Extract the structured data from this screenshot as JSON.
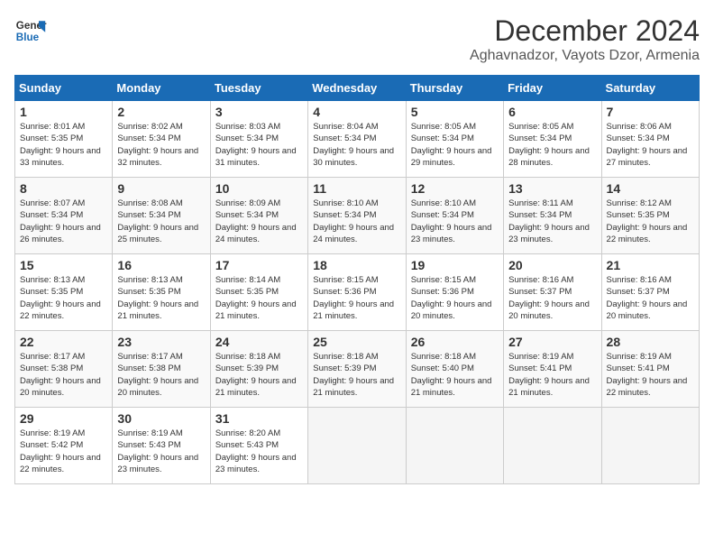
{
  "logo": {
    "line1": "General",
    "line2": "Blue"
  },
  "title": "December 2024",
  "subtitle": "Aghavnadzor, Vayots Dzor, Armenia",
  "days_of_week": [
    "Sunday",
    "Monday",
    "Tuesday",
    "Wednesday",
    "Thursday",
    "Friday",
    "Saturday"
  ],
  "weeks": [
    [
      {
        "day": "1",
        "sunrise": "8:01 AM",
        "sunset": "5:35 PM",
        "daylight": "9 hours and 33 minutes."
      },
      {
        "day": "2",
        "sunrise": "8:02 AM",
        "sunset": "5:34 PM",
        "daylight": "9 hours and 32 minutes."
      },
      {
        "day": "3",
        "sunrise": "8:03 AM",
        "sunset": "5:34 PM",
        "daylight": "9 hours and 31 minutes."
      },
      {
        "day": "4",
        "sunrise": "8:04 AM",
        "sunset": "5:34 PM",
        "daylight": "9 hours and 30 minutes."
      },
      {
        "day": "5",
        "sunrise": "8:05 AM",
        "sunset": "5:34 PM",
        "daylight": "9 hours and 29 minutes."
      },
      {
        "day": "6",
        "sunrise": "8:05 AM",
        "sunset": "5:34 PM",
        "daylight": "9 hours and 28 minutes."
      },
      {
        "day": "7",
        "sunrise": "8:06 AM",
        "sunset": "5:34 PM",
        "daylight": "9 hours and 27 minutes."
      }
    ],
    [
      {
        "day": "8",
        "sunrise": "8:07 AM",
        "sunset": "5:34 PM",
        "daylight": "9 hours and 26 minutes."
      },
      {
        "day": "9",
        "sunrise": "8:08 AM",
        "sunset": "5:34 PM",
        "daylight": "9 hours and 25 minutes."
      },
      {
        "day": "10",
        "sunrise": "8:09 AM",
        "sunset": "5:34 PM",
        "daylight": "9 hours and 24 minutes."
      },
      {
        "day": "11",
        "sunrise": "8:10 AM",
        "sunset": "5:34 PM",
        "daylight": "9 hours and 24 minutes."
      },
      {
        "day": "12",
        "sunrise": "8:10 AM",
        "sunset": "5:34 PM",
        "daylight": "9 hours and 23 minutes."
      },
      {
        "day": "13",
        "sunrise": "8:11 AM",
        "sunset": "5:34 PM",
        "daylight": "9 hours and 23 minutes."
      },
      {
        "day": "14",
        "sunrise": "8:12 AM",
        "sunset": "5:35 PM",
        "daylight": "9 hours and 22 minutes."
      }
    ],
    [
      {
        "day": "15",
        "sunrise": "8:13 AM",
        "sunset": "5:35 PM",
        "daylight": "9 hours and 22 minutes."
      },
      {
        "day": "16",
        "sunrise": "8:13 AM",
        "sunset": "5:35 PM",
        "daylight": "9 hours and 21 minutes."
      },
      {
        "day": "17",
        "sunrise": "8:14 AM",
        "sunset": "5:35 PM",
        "daylight": "9 hours and 21 minutes."
      },
      {
        "day": "18",
        "sunrise": "8:15 AM",
        "sunset": "5:36 PM",
        "daylight": "9 hours and 21 minutes."
      },
      {
        "day": "19",
        "sunrise": "8:15 AM",
        "sunset": "5:36 PM",
        "daylight": "9 hours and 20 minutes."
      },
      {
        "day": "20",
        "sunrise": "8:16 AM",
        "sunset": "5:37 PM",
        "daylight": "9 hours and 20 minutes."
      },
      {
        "day": "21",
        "sunrise": "8:16 AM",
        "sunset": "5:37 PM",
        "daylight": "9 hours and 20 minutes."
      }
    ],
    [
      {
        "day": "22",
        "sunrise": "8:17 AM",
        "sunset": "5:38 PM",
        "daylight": "9 hours and 20 minutes."
      },
      {
        "day": "23",
        "sunrise": "8:17 AM",
        "sunset": "5:38 PM",
        "daylight": "9 hours and 20 minutes."
      },
      {
        "day": "24",
        "sunrise": "8:18 AM",
        "sunset": "5:39 PM",
        "daylight": "9 hours and 21 minutes."
      },
      {
        "day": "25",
        "sunrise": "8:18 AM",
        "sunset": "5:39 PM",
        "daylight": "9 hours and 21 minutes."
      },
      {
        "day": "26",
        "sunrise": "8:18 AM",
        "sunset": "5:40 PM",
        "daylight": "9 hours and 21 minutes."
      },
      {
        "day": "27",
        "sunrise": "8:19 AM",
        "sunset": "5:41 PM",
        "daylight": "9 hours and 21 minutes."
      },
      {
        "day": "28",
        "sunrise": "8:19 AM",
        "sunset": "5:41 PM",
        "daylight": "9 hours and 22 minutes."
      }
    ],
    [
      {
        "day": "29",
        "sunrise": "8:19 AM",
        "sunset": "5:42 PM",
        "daylight": "9 hours and 22 minutes."
      },
      {
        "day": "30",
        "sunrise": "8:19 AM",
        "sunset": "5:43 PM",
        "daylight": "9 hours and 23 minutes."
      },
      {
        "day": "31",
        "sunrise": "8:20 AM",
        "sunset": "5:43 PM",
        "daylight": "9 hours and 23 minutes."
      },
      null,
      null,
      null,
      null
    ]
  ]
}
